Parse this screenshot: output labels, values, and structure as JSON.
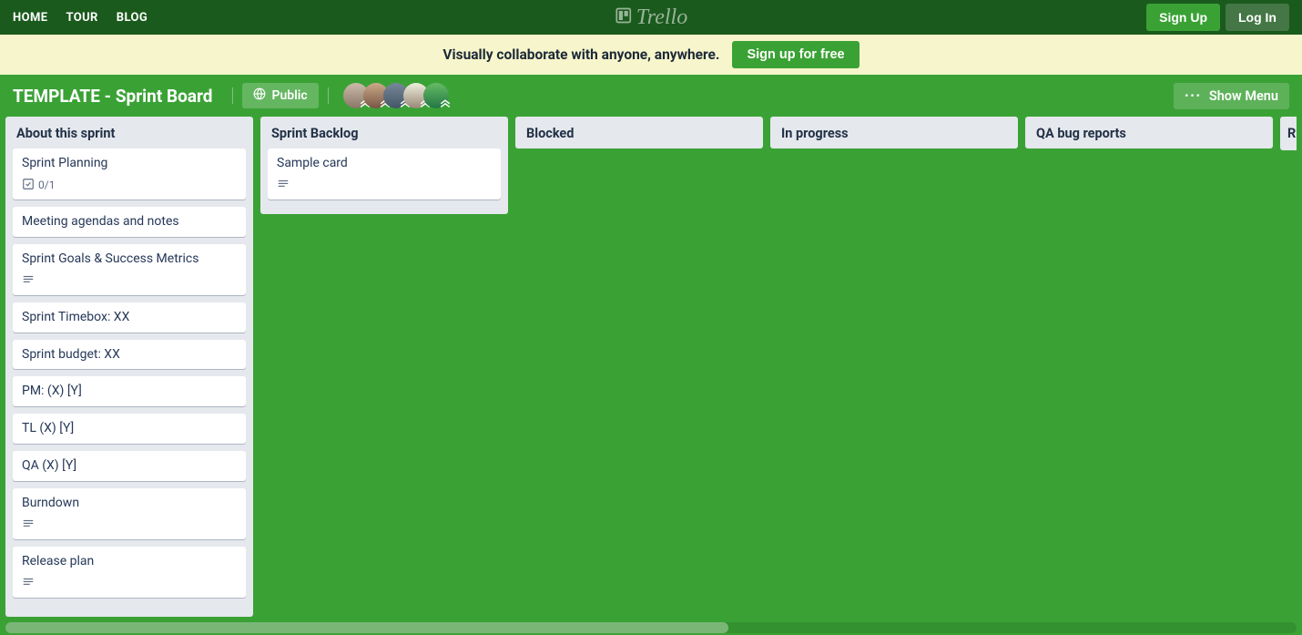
{
  "topbar": {
    "links": [
      "HOME",
      "TOUR",
      "BLOG"
    ],
    "logo_text": "Trello",
    "signup": "Sign Up",
    "login": "Log In"
  },
  "promo": {
    "text": "Visually collaborate with anyone, anywhere.",
    "cta": "Sign up for free"
  },
  "board": {
    "title": "TEMPLATE - Sprint Board",
    "visibility": "Public",
    "show_menu": "Show Menu",
    "member_count": 5
  },
  "lists": [
    {
      "title": "About this sprint",
      "cards": [
        {
          "title": "Sprint Planning",
          "checklist": "0/1"
        },
        {
          "title": "Meeting agendas and notes"
        },
        {
          "title": "Sprint Goals & Success Metrics",
          "has_description": true
        },
        {
          "title": "Sprint Timebox: XX"
        },
        {
          "title": "Sprint budget: XX"
        },
        {
          "title": "PM: (X) [Y]"
        },
        {
          "title": "TL (X) [Y]"
        },
        {
          "title": "QA (X) [Y]"
        },
        {
          "title": "Burndown",
          "has_description": true
        },
        {
          "title": "Release plan",
          "has_description": true
        }
      ]
    },
    {
      "title": "Sprint Backlog",
      "cards": [
        {
          "title": "Sample card",
          "has_description": true
        }
      ]
    },
    {
      "title": "Blocked",
      "cards": []
    },
    {
      "title": "In progress",
      "cards": []
    },
    {
      "title": "QA bug reports",
      "cards": []
    }
  ],
  "peek_list_title": "R"
}
